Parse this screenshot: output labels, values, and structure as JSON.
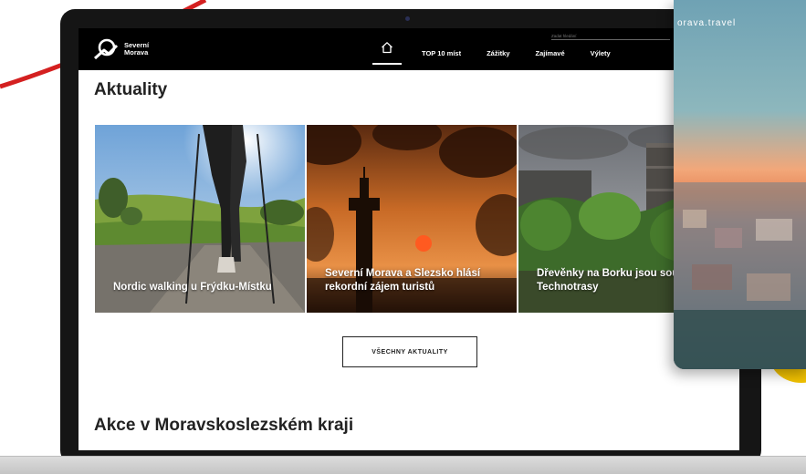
{
  "colors": {
    "header_bg": "#000000",
    "accent_red": "#d42020",
    "accent_yellow": "#f2c200"
  },
  "logo": {
    "line1": "Severní",
    "line2": "Morava"
  },
  "search": {
    "placeholder": "Zadat hledání"
  },
  "nav": {
    "home_icon": "home-icon",
    "items": [
      "TOP 10 míst",
      "Zážitky",
      "Zajímavé",
      "Výlety"
    ]
  },
  "news": {
    "title": "Aktuality",
    "cards": [
      {
        "title": "Nordic walking u Frýdku-Místku"
      },
      {
        "title": "Severní Morava a Slezsko hlásí rekordní zájem turistů"
      },
      {
        "title": "Dřevěnky na Borku jsou součástí Technotrasy"
      }
    ],
    "all_button": "VŠECHNY AKTUALITY"
  },
  "events": {
    "title": "Akce v Moravskoslezském kraji"
  },
  "phone": {
    "url_text": "orava.travel"
  }
}
